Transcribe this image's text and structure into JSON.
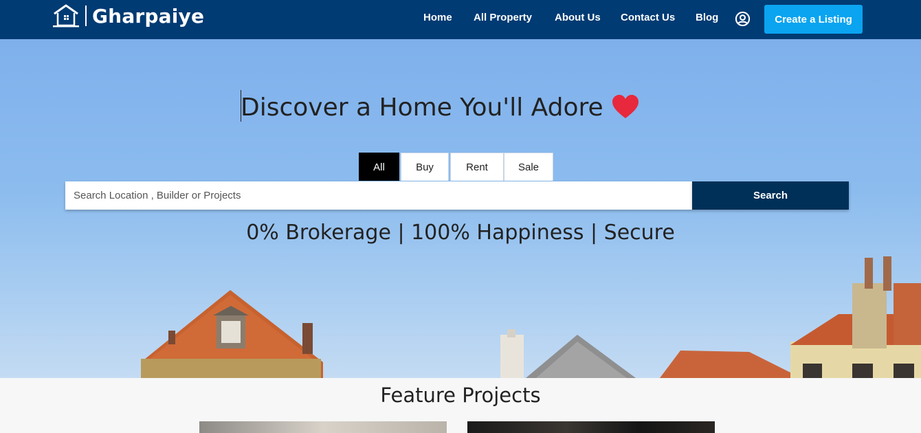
{
  "brand": {
    "name": "Gharpaiye",
    "icon": "home-icon"
  },
  "nav": {
    "links": [
      "Home",
      "All Property",
      "About Us",
      "Contact Us",
      "Blog"
    ],
    "user_icon": "user-circle-icon",
    "create_listing": "Create a Listing"
  },
  "hero": {
    "title": "Discover a Home You'll Adore",
    "title_icon": "heart-icon",
    "tabs": [
      "All",
      "Buy",
      "Rent",
      "Sale"
    ],
    "active_tab": "All",
    "search": {
      "placeholder": "Search Location , Builder or Projects",
      "value": "",
      "button": "Search"
    },
    "tagline": "0% Brokerage | 100% Happiness | Secure"
  },
  "feature": {
    "title": "Feature Projects"
  },
  "colors": {
    "nav_bg": "#003b73",
    "create_btn": "#0aa4f0",
    "search_btn": "#003057",
    "heart": "#e8283c",
    "sky": "#7fb0ec"
  }
}
